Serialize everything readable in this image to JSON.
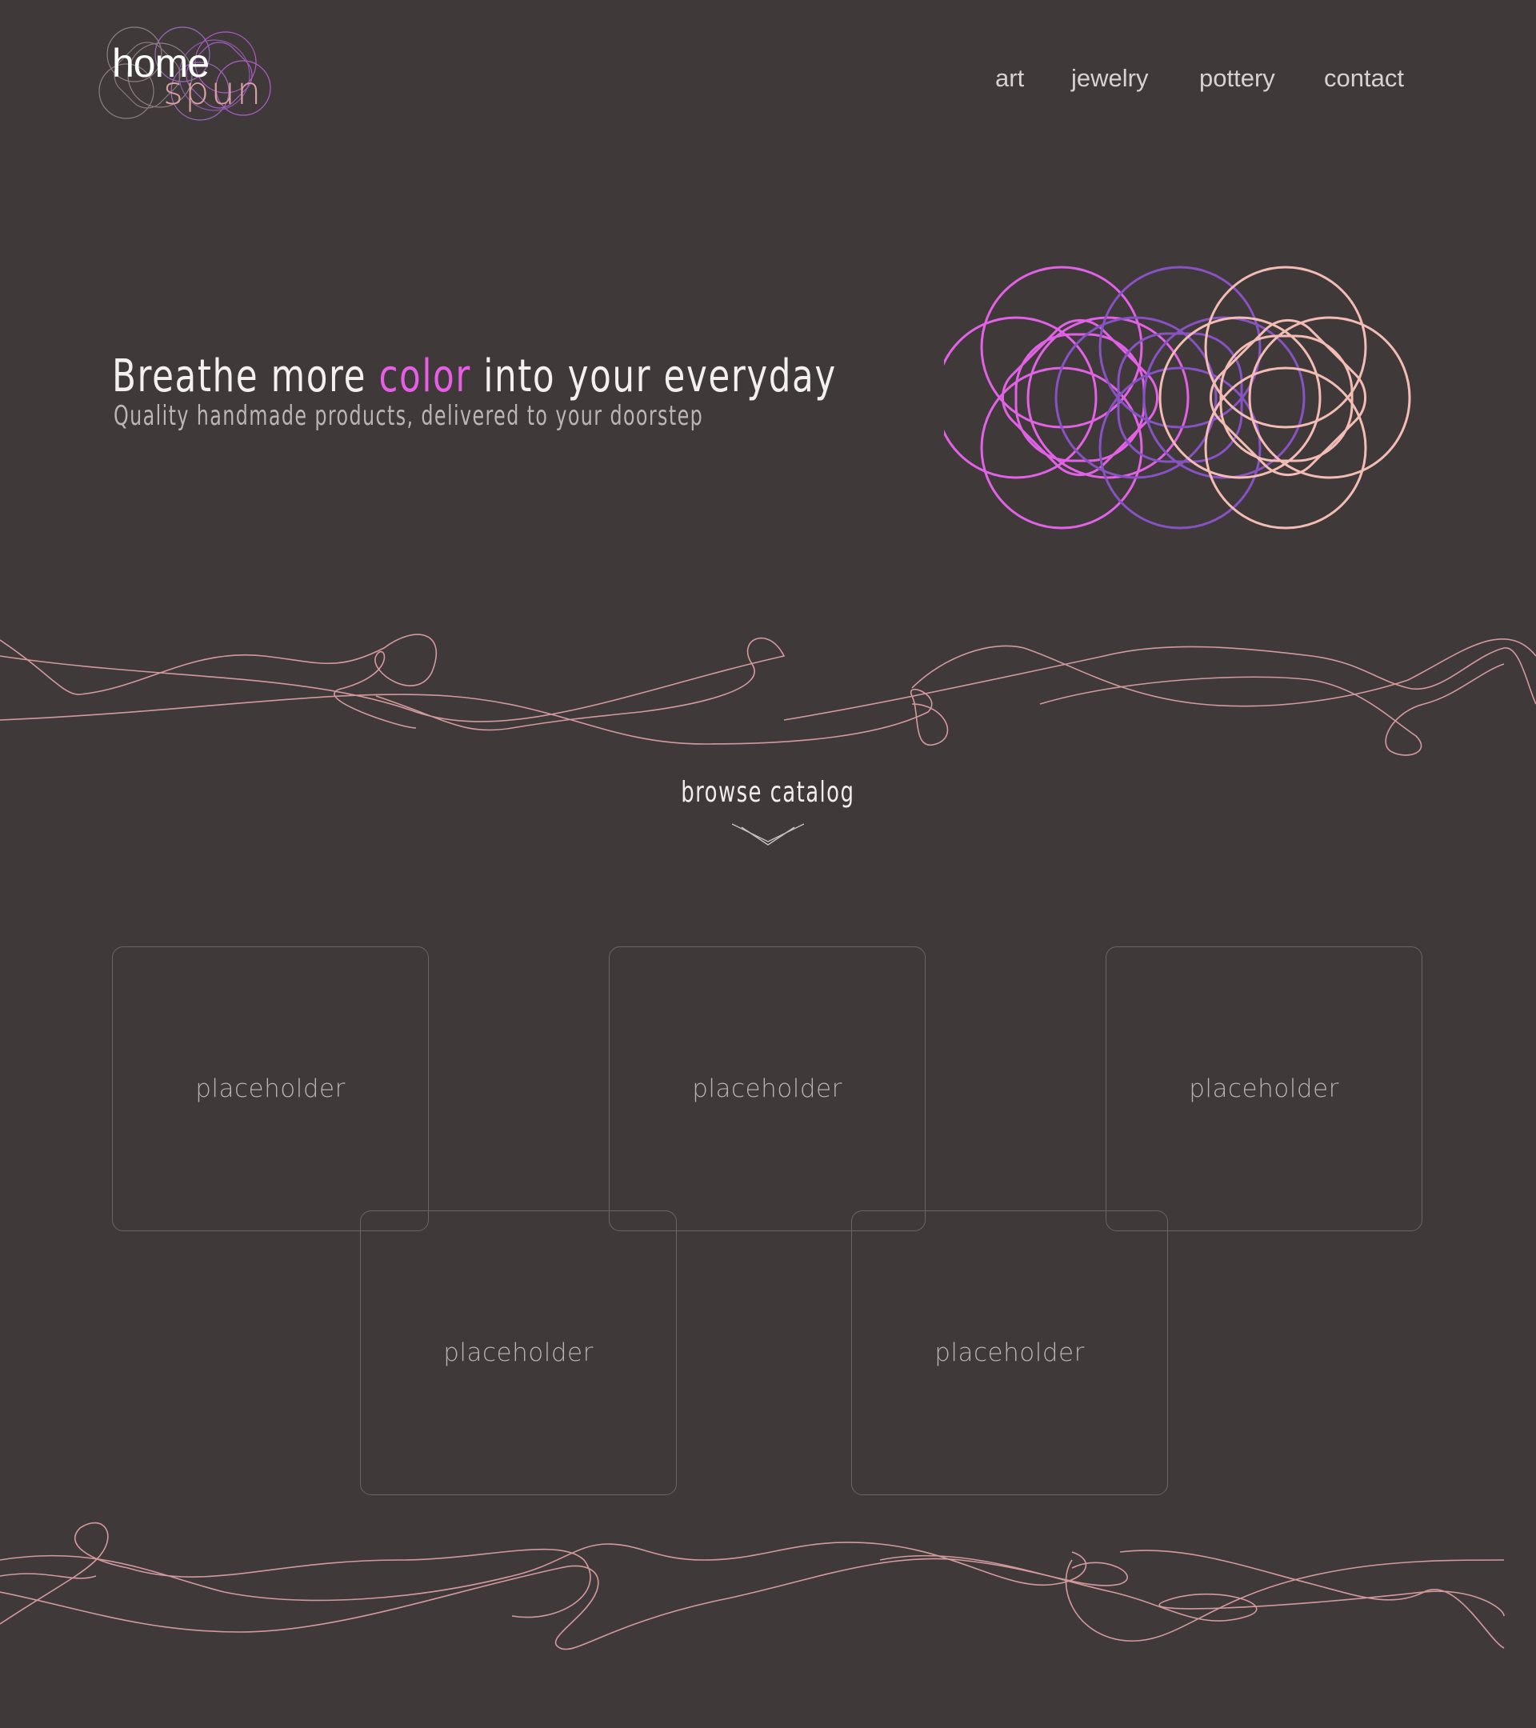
{
  "logo": {
    "line1": "home",
    "line2": "spun",
    "icon": "circles-logo-icon"
  },
  "nav": {
    "items": [
      {
        "label": "art"
      },
      {
        "label": "jewelry"
      },
      {
        "label": "pottery"
      },
      {
        "label": "contact"
      }
    ]
  },
  "hero": {
    "title_before": "Breathe more ",
    "title_accent": "color",
    "title_after": " into your everyday",
    "subtitle": "Quality handmade products, delivered to your doorstep",
    "art_icon": "overlapping-shapes-art"
  },
  "browse": {
    "label": "browse catalog",
    "icon": "chevron-down-icon"
  },
  "catalog": {
    "items": [
      {
        "label": "placeholder"
      },
      {
        "label": "placeholder"
      },
      {
        "label": "placeholder"
      },
      {
        "label": "placeholder"
      },
      {
        "label": "placeholder"
      }
    ]
  },
  "colors": {
    "background": "#3f393a",
    "accent_magenta": "#e65ee6",
    "accent_purple": "#8a55c4",
    "accent_pink": "#f2b8b4",
    "wave_line": "#d99aa0"
  }
}
